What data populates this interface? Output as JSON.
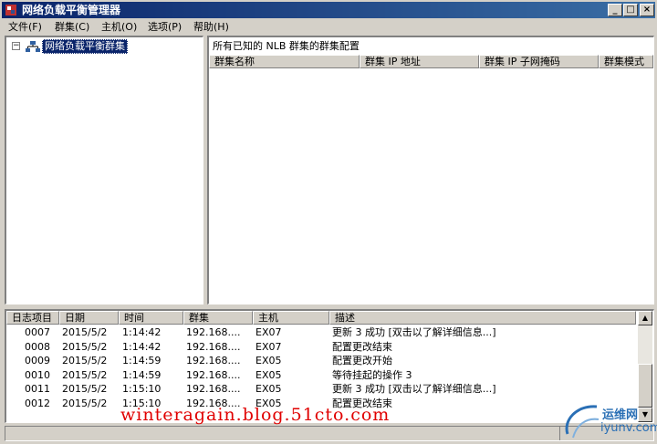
{
  "window": {
    "title": "网络负载平衡管理器",
    "min": "_",
    "max": "□",
    "close": "×"
  },
  "menu": [
    "文件(F)",
    "群集(C)",
    "主机(O)",
    "选项(P)",
    "帮助(H)"
  ],
  "tree": {
    "expander": "−",
    "root_label": "网络负载平衡群集"
  },
  "right": {
    "caption": "所有已知的 NLB 群集的群集配置",
    "columns": [
      "群集名称",
      "群集 IP 地址",
      "群集 IP 子网掩码",
      "群集模式"
    ]
  },
  "log": {
    "columns": [
      "日志项目",
      "日期",
      "时间",
      "群集",
      "主机",
      "描述"
    ],
    "rows": [
      [
        "0007",
        "2015/5/2",
        "1:14:42",
        "192.168....",
        "EX07",
        "更新 3 成功 [双击以了解详细信息...]"
      ],
      [
        "0008",
        "2015/5/2",
        "1:14:42",
        "192.168....",
        "EX07",
        "配置更改结束"
      ],
      [
        "0009",
        "2015/5/2",
        "1:14:59",
        "192.168....",
        "EX05",
        "配置更改开始"
      ],
      [
        "0010",
        "2015/5/2",
        "1:14:59",
        "192.168....",
        "EX05",
        "等待挂起的操作 3"
      ],
      [
        "0011",
        "2015/5/2",
        "1:15:10",
        "192.168....",
        "EX05",
        "更新 3 成功 [双击以了解详细信息...]"
      ],
      [
        "0012",
        "2015/5/2",
        "1:15:10",
        "192.168....",
        "EX05",
        "配置更改结束"
      ]
    ]
  },
  "scroll": {
    "up": "▲",
    "down": "▼"
  },
  "watermark": "winteragain.blog.51cto.com",
  "logo": {
    "line1": "运维网",
    "line2": "iyunv.com"
  },
  "colors": {
    "titlebar_start": "#0a246a",
    "titlebar_end": "#3a6ea5",
    "watermark": "#e00000",
    "logo": "#2a6fb5"
  }
}
